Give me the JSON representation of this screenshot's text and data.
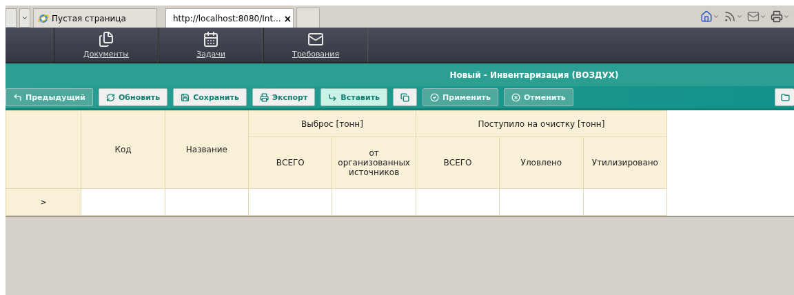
{
  "browser_tabs": [
    {
      "title": "Пустая страница",
      "selected": false
    },
    {
      "title": "http://localhost:8080/Int...",
      "selected": true,
      "close": "×"
    }
  ],
  "nav": [
    {
      "label": "Документы"
    },
    {
      "label": "Задачи"
    },
    {
      "label": "Требования"
    }
  ],
  "title": "Новый - Инвентаризация (ВОЗДУХ)",
  "toolbar": [
    {
      "kind": "button",
      "label": "Предыдущий",
      "disabled": true,
      "highlighted": false
    },
    {
      "kind": "button",
      "label": "Обновить",
      "disabled": false,
      "highlighted": false
    },
    {
      "kind": "button",
      "label": "Сохранить",
      "disabled": false,
      "highlighted": false
    },
    {
      "kind": "button",
      "label": "Экспорт",
      "disabled": false,
      "highlighted": false
    },
    {
      "kind": "button",
      "label": "Вставить",
      "disabled": false,
      "highlighted": true
    },
    {
      "kind": "icon",
      "disabled": false,
      "highlighted": false
    },
    {
      "kind": "button",
      "label": "Применить",
      "disabled": true,
      "highlighted": false
    },
    {
      "kind": "button",
      "label": "Отменить",
      "disabled": true,
      "highlighted": false
    },
    {
      "kind": "edge",
      "disabled": false,
      "highlighted": false
    }
  ],
  "table": {
    "columns": [
      {
        "label": "Код"
      },
      {
        "label": "Название"
      },
      {
        "label": "Выброс [тонн]",
        "children": [
          {
            "label": "ВСЕГО"
          },
          {
            "label": "от организованных источников"
          }
        ]
      },
      {
        "label": "Поступило на очистку [тонн]",
        "children": [
          {
            "label": "ВСЕГО"
          },
          {
            "label": "Уловлено"
          },
          {
            "label": "Утилизировано"
          }
        ]
      }
    ],
    "rows": [
      {
        "marker": ">"
      }
    ]
  }
}
